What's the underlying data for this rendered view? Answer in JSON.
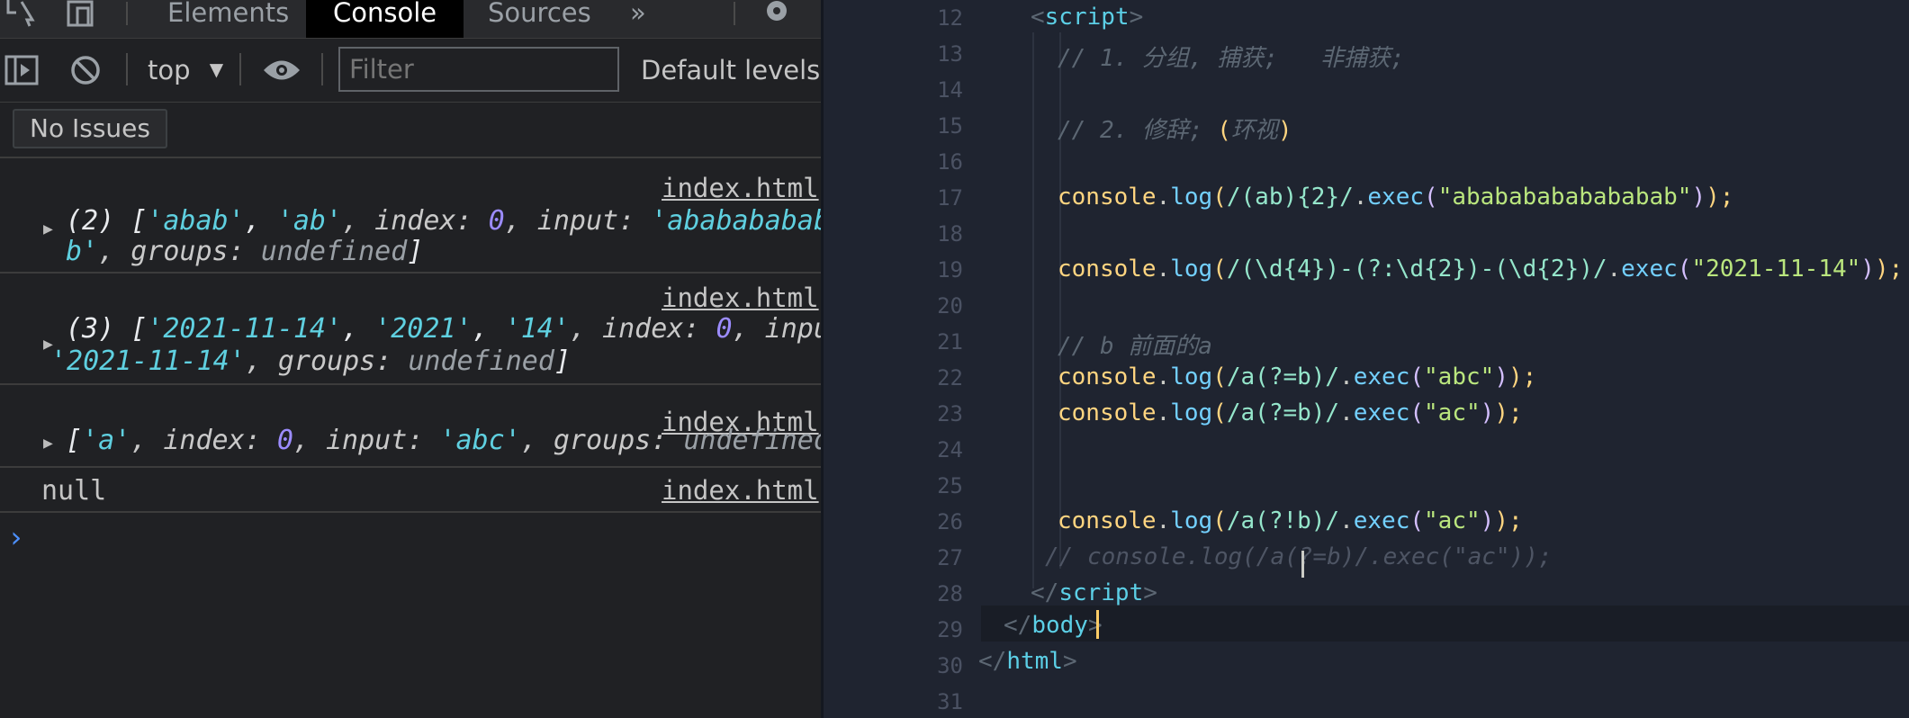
{
  "devtools": {
    "tabs": [
      {
        "label": "Elements"
      },
      {
        "label": "Console"
      },
      {
        "label": "Sources"
      }
    ],
    "more_tabs_glyph": "»",
    "toolbar": {
      "context": "top",
      "filter_placeholder": "Filter",
      "levels": "Default levels"
    },
    "issues": "No Issues",
    "messages": [
      {
        "source": "index.html",
        "line1": [
          "(2) [",
          "'abab'",
          ", ",
          "'ab'",
          ", index: ",
          "0",
          ", input: ",
          "'abababababababab"
        ],
        "line2": [
          "b'",
          ", groups: ",
          "undefined",
          "]"
        ]
      },
      {
        "source": "index.html",
        "line1": [
          "(3) [",
          "'2021-11-14'",
          ", ",
          "'2021'",
          ", ",
          "'14'",
          ", index: ",
          "0",
          ", input:"
        ],
        "line2": [
          "'2021-11-14'",
          ", groups: ",
          "undefined",
          "]"
        ]
      },
      {
        "source": "index.html",
        "line1": [
          "[",
          "'a'",
          ", index: ",
          "0",
          ", input: ",
          "'abc'",
          ", groups: ",
          "undefined]"
        ]
      },
      {
        "source": "index.html",
        "text": "null"
      }
    ],
    "prompt": "›"
  },
  "editor": {
    "line_numbers": [
      "12",
      "13",
      "14",
      "15",
      "16",
      "17",
      "18",
      "19",
      "20",
      "21",
      "22",
      "23",
      "24",
      "25",
      "26",
      "27",
      "28",
      "29",
      "30",
      "31"
    ],
    "code": {
      "l12_open": "<",
      "l12_tag": "script",
      "l12_close": ">",
      "l13": "// 1. 分组, 捕获;   非捕获;",
      "l15_a": "// 2. 修辞; ",
      "l15_p": "(",
      "l15_b": "环视",
      "l15_q": ")",
      "l17": [
        "console",
        ".",
        "log",
        "(",
        "/(ab){2}/",
        ".",
        "exec",
        "(",
        "\"abababababababab\"",
        ")",
        ");"
      ],
      "l19": [
        "console",
        ".",
        "log",
        "(",
        "/(\\d{4})-(?:\\d{2})-(\\d{2})/",
        ".",
        "exec",
        "(",
        "\"2021-11-14\"",
        ")",
        ");"
      ],
      "l21": "// b 前面的a",
      "l22": [
        "console",
        ".",
        "log",
        "(",
        "/a(?=b)/",
        ".",
        "exec",
        "(",
        "\"abc\"",
        ")",
        ");"
      ],
      "l23": [
        "console",
        ".",
        "log",
        "(",
        "/a(?=b)/",
        ".",
        "exec",
        "(",
        "\"ac\"",
        ")",
        ");"
      ],
      "l26": [
        "console",
        ".",
        "log",
        "(",
        "/a(?!b)/",
        ".",
        "exec",
        "(",
        "\"ac\"",
        ")",
        ");"
      ],
      "l27": "// console.log(/a(?=b)/.exec(\"ac\"));",
      "l28_open": "</",
      "l28_tag": "script",
      "l28_close": ">",
      "l29_open": "</",
      "l29_tag": "body",
      "l29_close": ">",
      "l30_open": "</",
      "l30_tag": "html",
      "l30_close": ">"
    }
  },
  "colors": {
    "devtools_bg": "#202124",
    "editor_bg": "#1f2430",
    "string": "#5fd0e0",
    "number": "#9c8cff",
    "tag": "#5ccfe6",
    "function": "#ffd580",
    "code_string": "#bae67e",
    "comment": "#5c6773"
  }
}
